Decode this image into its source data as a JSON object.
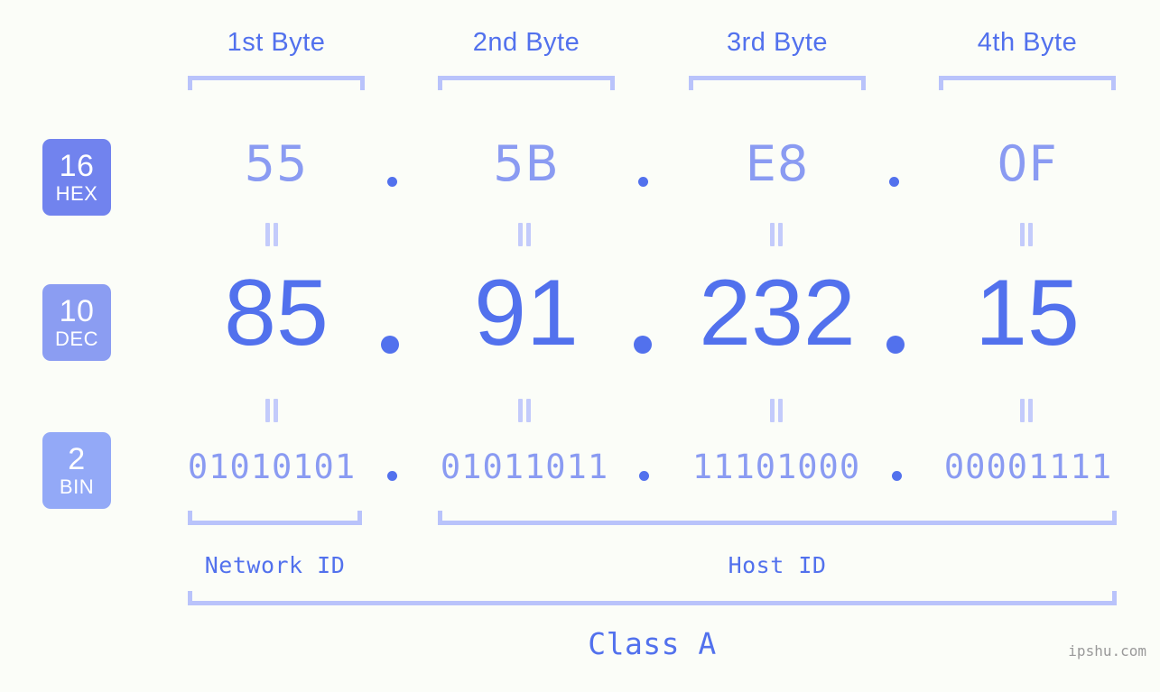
{
  "background_color": "#fbfdf8",
  "accent_color": "#5271ed",
  "muted_accent_color": "#8a9bf2",
  "bracket_color": "#b9c3fb",
  "byte_headers": [
    {
      "label": "1st Byte"
    },
    {
      "label": "2nd Byte"
    },
    {
      "label": "3rd Byte"
    },
    {
      "label": "4th Byte"
    }
  ],
  "rows": {
    "hex": {
      "badge_number": "16",
      "badge_name": "HEX",
      "badge_color": "#7183ee",
      "values": [
        "55",
        "5B",
        "E8",
        "0F"
      ],
      "separator": "."
    },
    "dec": {
      "badge_number": "10",
      "badge_name": "DEC",
      "badge_color": "#8b9df2",
      "values": [
        "85",
        "91",
        "232",
        "15"
      ],
      "separator": "."
    },
    "bin": {
      "badge_number": "2",
      "badge_name": "BIN",
      "badge_color": "#93a9f7",
      "values": [
        "01010101",
        "01011011",
        "11101000",
        "00001111"
      ],
      "separator": "."
    }
  },
  "equality_mark": "=",
  "sections": {
    "network_id": "Network ID",
    "host_id": "Host ID",
    "class": "Class A"
  },
  "watermark": "ipshu.com"
}
